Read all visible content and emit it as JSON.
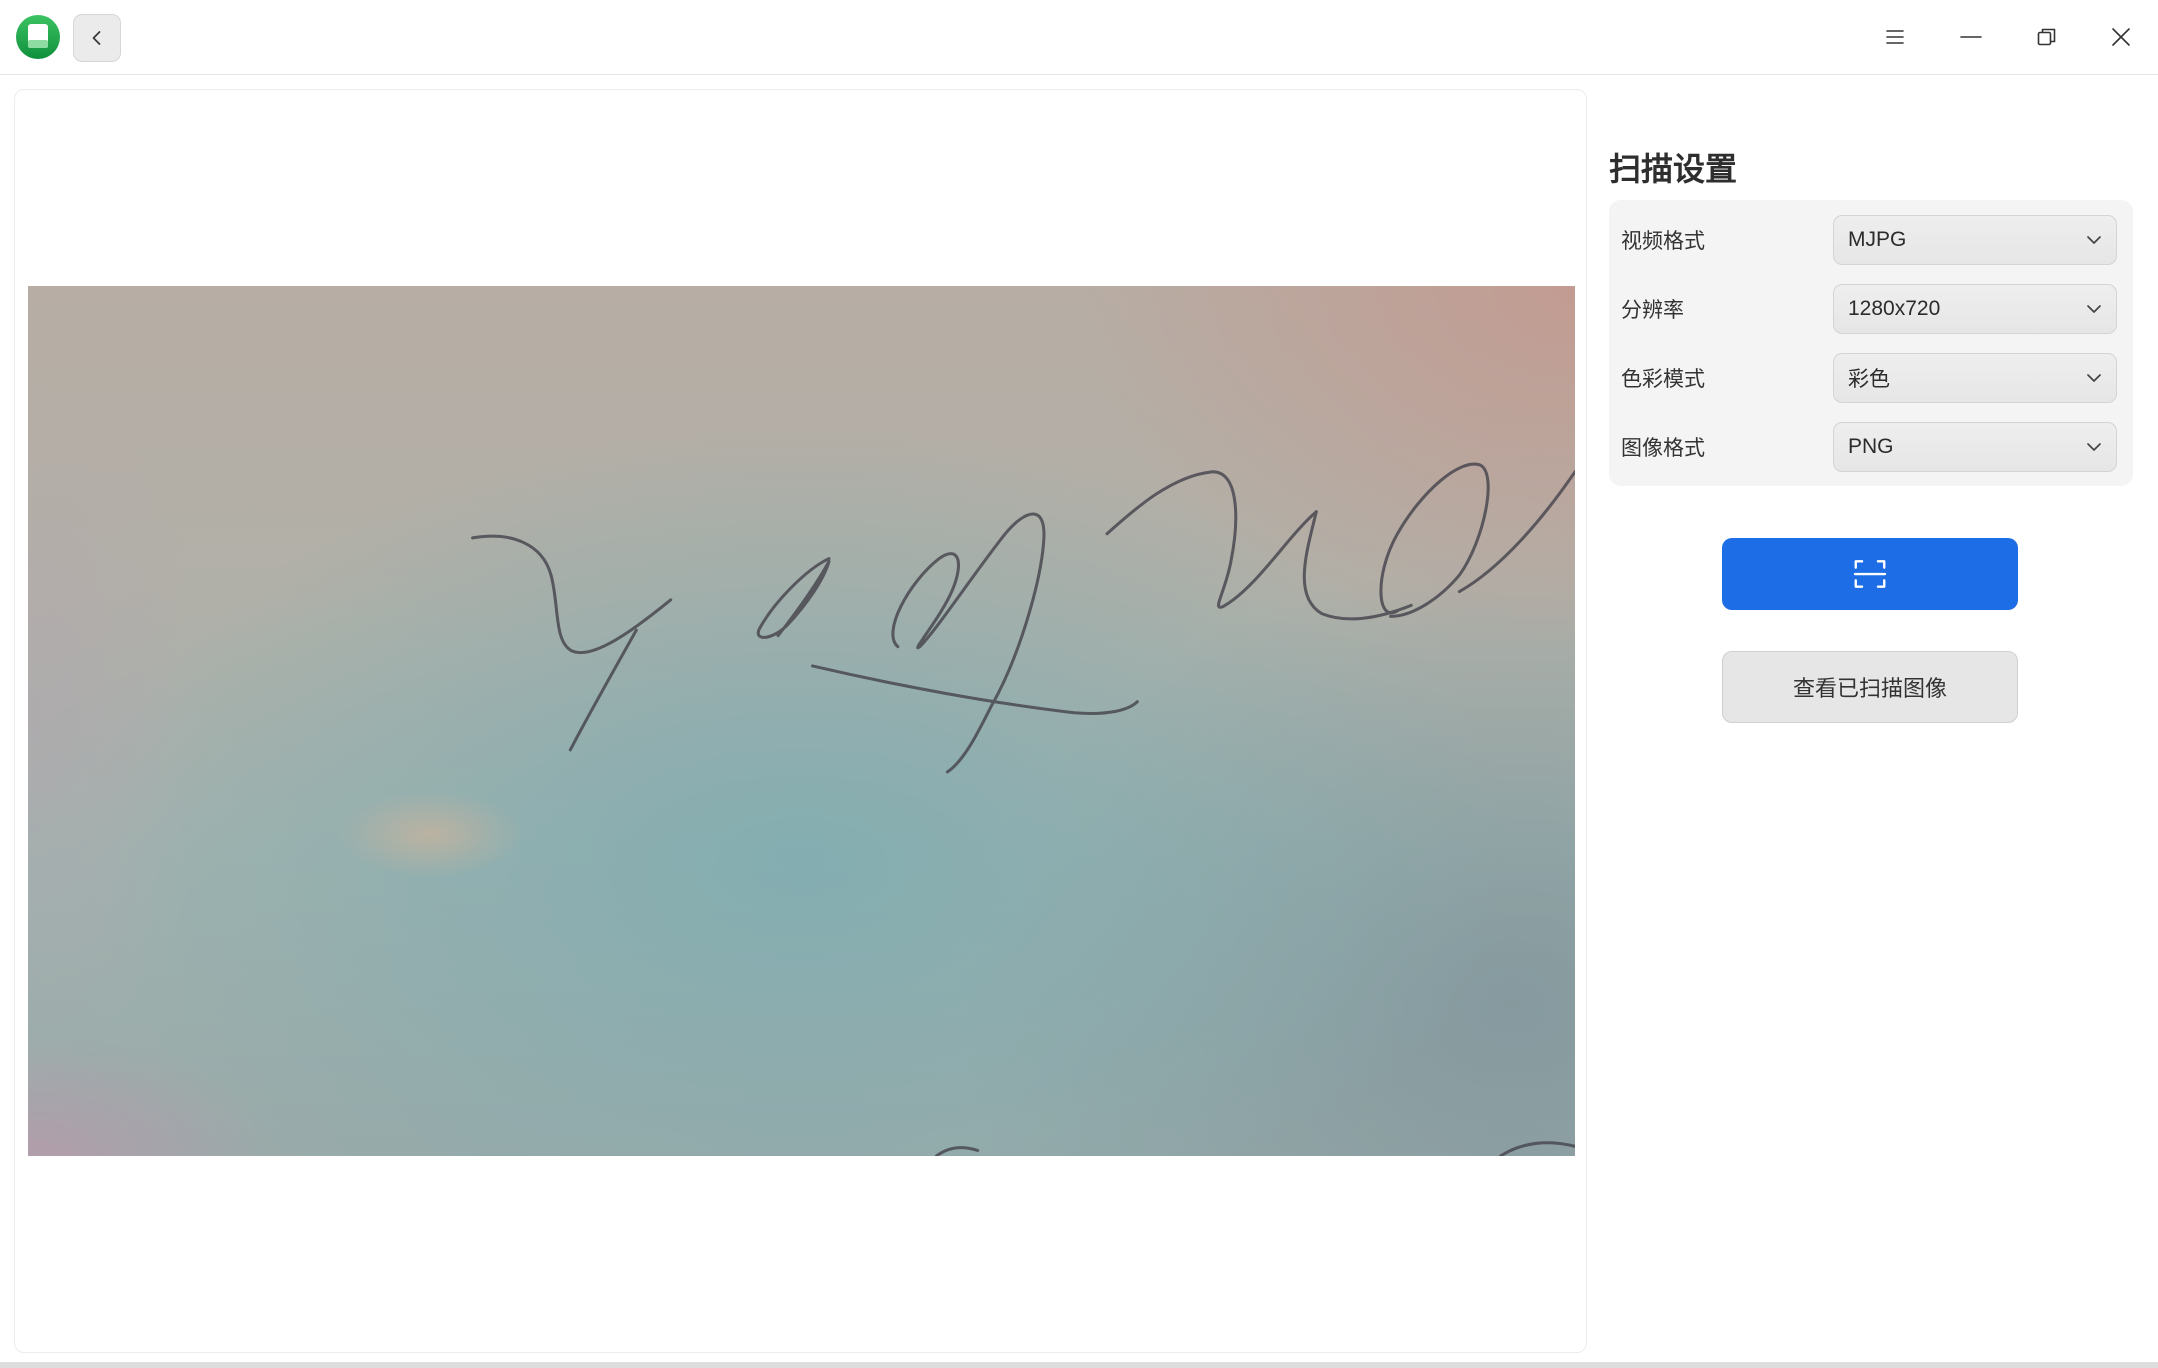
{
  "titlebar": {
    "icons": {
      "app": "app-icon",
      "back": "chevron-left-icon",
      "menu": "menu-icon",
      "minimize": "minimize-icon",
      "maximize": "restore-icon",
      "close": "close-icon"
    }
  },
  "settings": {
    "title": "扫描设置",
    "rows": [
      {
        "label": "视频格式",
        "value": "MJPG"
      },
      {
        "label": "分辨率",
        "value": "1280x720"
      },
      {
        "label": "色彩模式",
        "value": "彩色"
      },
      {
        "label": "图像格式",
        "value": "PNG"
      }
    ],
    "dropdown_icon": "chevron-down-icon"
  },
  "actions": {
    "scan_icon": "scan-icon",
    "view_label": "查看已扫描图像"
  },
  "colors": {
    "accent": "#1d6de6",
    "app_icon_green": "#1aa64b"
  }
}
